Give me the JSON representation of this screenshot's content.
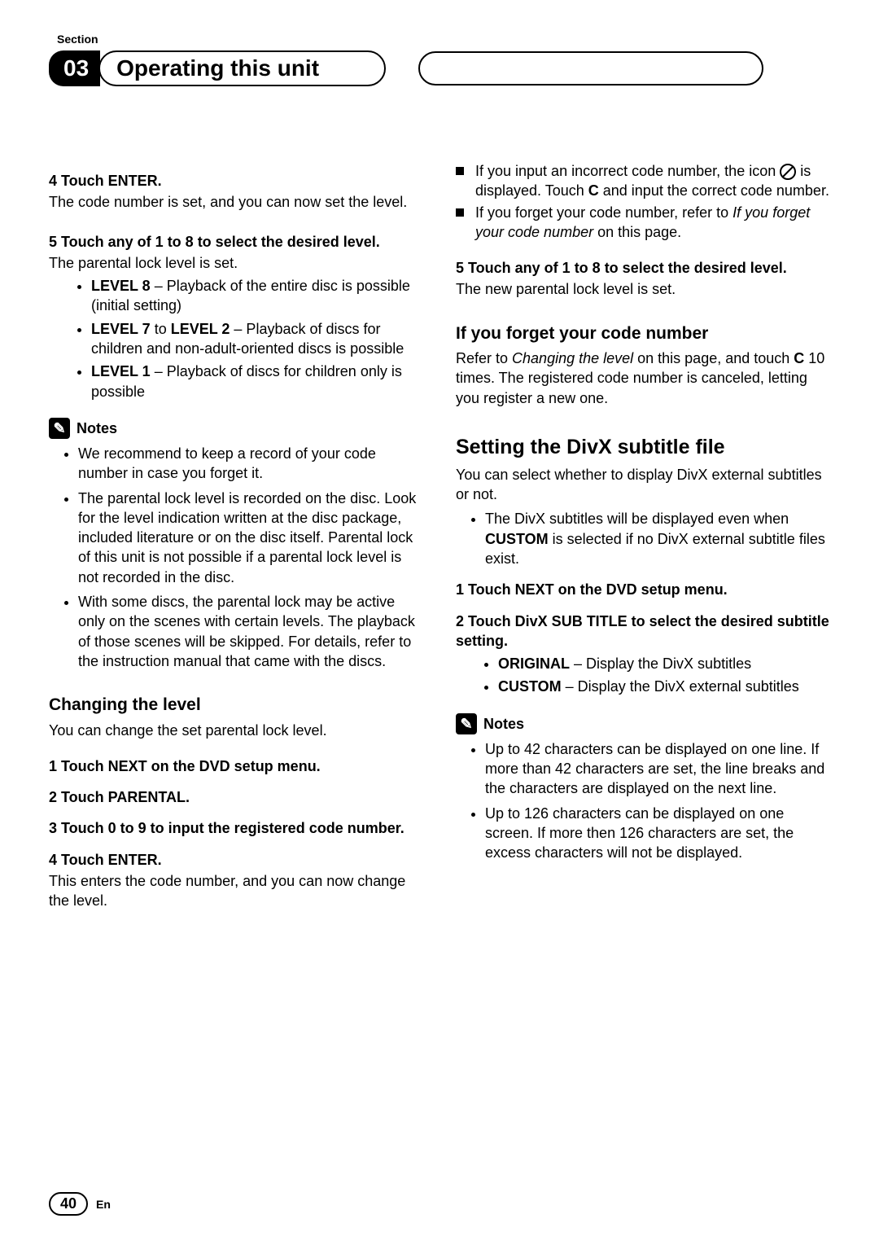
{
  "header": {
    "section_label": "Section",
    "chapter_num": "03",
    "chapter_title": "Operating this unit"
  },
  "left": {
    "s4_head": "4   Touch ENTER.",
    "s4_body": "The code number is set, and you can now set the level.",
    "s5_head": "5   Touch any of 1 to 8 to select the desired level.",
    "s5_body": "The parental lock level is set.",
    "lvl8_b": "LEVEL 8",
    "lvl8_t": " – Playback of the entire disc is possible (initial setting)",
    "lvl72_b": "LEVEL 7",
    "lvl72_t1": " to ",
    "lvl72_b2": "LEVEL 2",
    "lvl72_t2": " – Playback of discs for children and non-adult-oriented discs is possible",
    "lvl1_b": "LEVEL 1",
    "lvl1_t": " – Playback of discs for children only is possible",
    "notes_label": "Notes",
    "note1": "We recommend to keep a record of your code number in case you forget it.",
    "note2": "The parental lock level is recorded on the disc. Look for the level indication written at the disc package, included literature or on the disc itself. Parental lock of this unit is not possible if a parental lock level is not recorded in the disc.",
    "note3": "With some discs, the parental lock may be active only on the scenes with certain levels. The playback of those scenes will be skipped. For details, refer to the instruction manual that came with the discs.",
    "chg_h": "Changing the level",
    "chg_intro": "You can change the set parental lock level.",
    "c1": "1   Touch NEXT on the DVD setup menu.",
    "c2": "2   Touch PARENTAL.",
    "c3": "3   Touch 0 to 9 to input the registered code number.",
    "c4": "4   Touch ENTER.",
    "c4_body": "This enters the code number, and you can now change the level."
  },
  "right": {
    "sq1_a": "If you input an incorrect code number, the icon ",
    "sq1_b": " is displayed. Touch ",
    "sq1_c": "C",
    "sq1_d": " and input the correct code number.",
    "sq2_a": "If you forget your code number, refer to ",
    "sq2_i": "If you forget your code number",
    "sq2_b": " on this page.",
    "r5_head": "5   Touch any of 1 to 8 to select the desired level.",
    "r5_body": "The new parental lock level is set.",
    "forget_h": "If you forget your code number",
    "forget_a": "Refer to ",
    "forget_i": "Changing the level",
    "forget_b": " on this page, and touch ",
    "forget_c": "C",
    "forget_d": " 10 times. The registered code number is canceled, letting you register a new one.",
    "divx_h": "Setting the DivX subtitle file",
    "divx_intro": "You can select whether to display DivX external subtitles or not.",
    "divx_b1a": "The DivX subtitles will be displayed even when ",
    "divx_b1b": "CUSTOM",
    "divx_b1c": " is selected if no DivX external subtitle files exist.",
    "d1": "1   Touch NEXT on the DVD setup menu.",
    "d2": "2   Touch DivX SUB TITLE to select the desired subtitle setting.",
    "orig_b": "ORIGINAL",
    "orig_t": " – Display the DivX subtitles",
    "cust_b": "CUSTOM",
    "cust_t": " – Display the DivX external subtitles",
    "notes_label": "Notes",
    "dn1": "Up to 42 characters can be displayed on one line. If more than 42 characters are set, the line breaks and the characters are displayed on the next line.",
    "dn2": "Up to 126 characters can be displayed on one screen. If more then 126 characters are set, the excess characters will not be displayed."
  },
  "footer": {
    "page": "40",
    "lang": "En"
  }
}
